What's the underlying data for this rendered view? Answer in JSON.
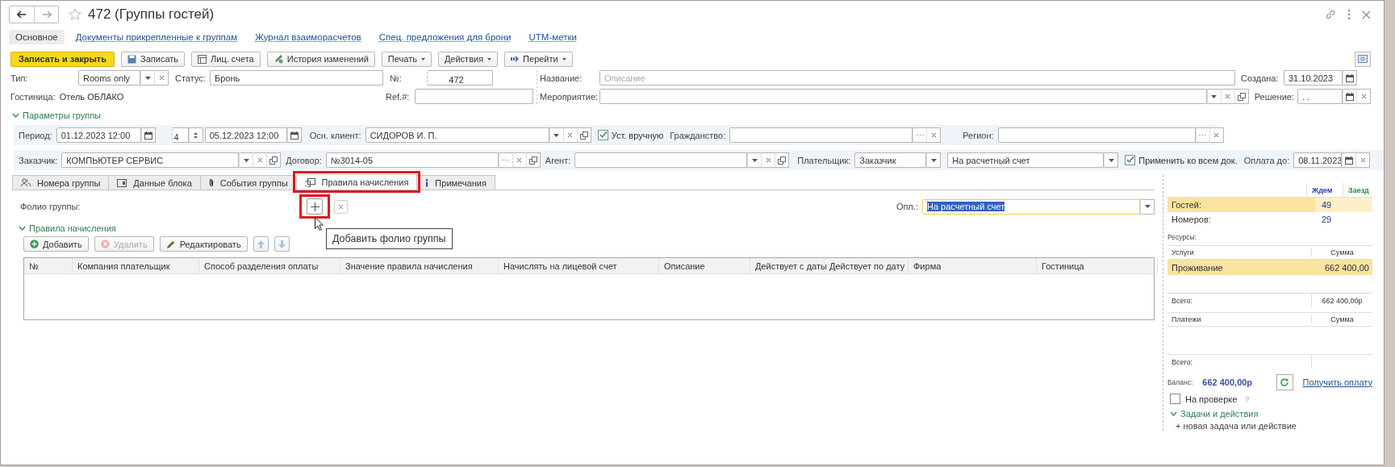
{
  "window": {
    "title": "472 (Группы гостей)",
    "favorite": false
  },
  "nav_tabs": [
    {
      "label": "Основное",
      "selected": true
    },
    {
      "label": "Документы прикрепленные к группам",
      "selected": false
    },
    {
      "label": "Журнал взаиморасчетов",
      "selected": false
    },
    {
      "label": "Спец. предложения для брони",
      "selected": false
    },
    {
      "label": "UTM-метки",
      "selected": false
    }
  ],
  "toolbar": [
    {
      "label": "Записать и закрыть",
      "kind": "primary"
    },
    {
      "label": "Записать",
      "kind": "save"
    },
    {
      "label": "Лиц. счета",
      "kind": "accounts"
    },
    {
      "label": "История изменений",
      "kind": "history"
    },
    {
      "label": "Печать",
      "kind": "menu"
    },
    {
      "label": "Действия",
      "kind": "menu"
    },
    {
      "label": "Перейти",
      "kind": "goto"
    }
  ],
  "header": {
    "type": {
      "label": "Тип:",
      "value": "Rooms only"
    },
    "status": {
      "label": "Статус:",
      "value": "Бронь"
    },
    "number": {
      "label": "№:",
      "value": "472"
    },
    "name": {
      "label": "Название:",
      "placeholder": "Описание"
    },
    "created": {
      "label": "Создана:",
      "value": "31.10.2023"
    },
    "hotel": {
      "label": "Гостиница:",
      "value": "Отель ОБЛАКО"
    },
    "ref": {
      "label": "Ref.#:"
    },
    "event": {
      "label": "Мероприятие:"
    },
    "decision": {
      "label": "Решение:",
      "value": ". ."
    }
  },
  "group_params": {
    "title": "Параметры группы",
    "expanded": true,
    "period": {
      "label": "Период:",
      "from": "01.12.2023 12:00",
      "nights": "4",
      "to": "05.12.2023 12:00"
    },
    "main_client": {
      "label": "Осн. клиент:",
      "value": "СИДОРОВ И. П."
    },
    "manual": {
      "label": "Уст. вручную",
      "checked": true
    },
    "citizenship": {
      "label": "Гражданство:"
    },
    "region": {
      "label": "Регион:"
    },
    "customer": {
      "label": "Заказчик:",
      "value": "КОМПЬЮТЕР СЕРВИС"
    },
    "contract": {
      "label": "Договор:",
      "value": "№3014-05"
    },
    "agent": {
      "label": "Агент:"
    },
    "payer": {
      "label": "Плательщик:",
      "value": "Заказчик"
    },
    "payment_method": {
      "value": "На расчетный счет"
    },
    "apply_all": {
      "label": "Применить ко всем док.",
      "checked": true
    },
    "pay_until": {
      "label": "Оплата до:",
      "value": "08.11.2023"
    }
  },
  "tabs": [
    {
      "label": "Номера группы",
      "kind": "people",
      "selected": false,
      "highlighted": false
    },
    {
      "label": "Данные блока",
      "kind": "block",
      "selected": false,
      "highlighted": false
    },
    {
      "label": "События группы",
      "kind": "clip",
      "selected": false,
      "highlighted": false
    },
    {
      "label": "Правила начисления",
      "kind": "rules",
      "selected": true,
      "highlighted": true
    },
    {
      "label": "Примечания",
      "kind": "info",
      "selected": false,
      "highlighted": false
    }
  ],
  "folio": {
    "label": "Фолио группы:",
    "add_highlighted": true,
    "tooltip": "Добавить фолио группы",
    "payment_label": "Опл.:",
    "payment_value": "На расчетный счет"
  },
  "rules": {
    "title": "Правила начисления",
    "expanded": true,
    "buttons": [
      {
        "label": "Добавить",
        "kind": "add",
        "disabled": false
      },
      {
        "label": "Удалить",
        "kind": "delete",
        "disabled": true
      },
      {
        "label": "Редактировать",
        "kind": "edit",
        "disabled": false
      },
      {
        "kind": "up",
        "disabled": true
      },
      {
        "kind": "down",
        "disabled": true
      }
    ],
    "columns": [
      "№",
      "Компания плательщик",
      "Способ разделения оплаты",
      "Значение правила начисления",
      "Начислять на лицевой счет",
      "Описание",
      "Действует с даты",
      "Действует по дату",
      "Фирма",
      "Гостиница"
    ]
  },
  "summary": {
    "columns": [
      "Ждем",
      "Заезд"
    ],
    "rows": [
      {
        "label": "Гостей:",
        "value": "49",
        "selected": true
      },
      {
        "label": "Номеров:",
        "value": "29",
        "selected": false
      }
    ],
    "resources_label": "Ресурсы:",
    "services": {
      "columns": [
        "Услуги",
        "Сумма"
      ],
      "rows": [
        {
          "name": "Проживание",
          "amount": "662 400,00",
          "selected": true
        }
      ],
      "total_label": "Всего:",
      "total": "662 400,00р"
    },
    "payments": {
      "columns": [
        "Платежи",
        "Сумма"
      ],
      "total_label": "Всего:"
    },
    "balance_label": "Баланс:",
    "balance": "662 400,00р",
    "get_payment": "Получить оплату",
    "on_review": {
      "label": "На проверке",
      "checked": false,
      "help": "?"
    },
    "tasks": {
      "title": "Задачи и действия",
      "expanded": true,
      "new": "+ новая задача или действие"
    }
  }
}
